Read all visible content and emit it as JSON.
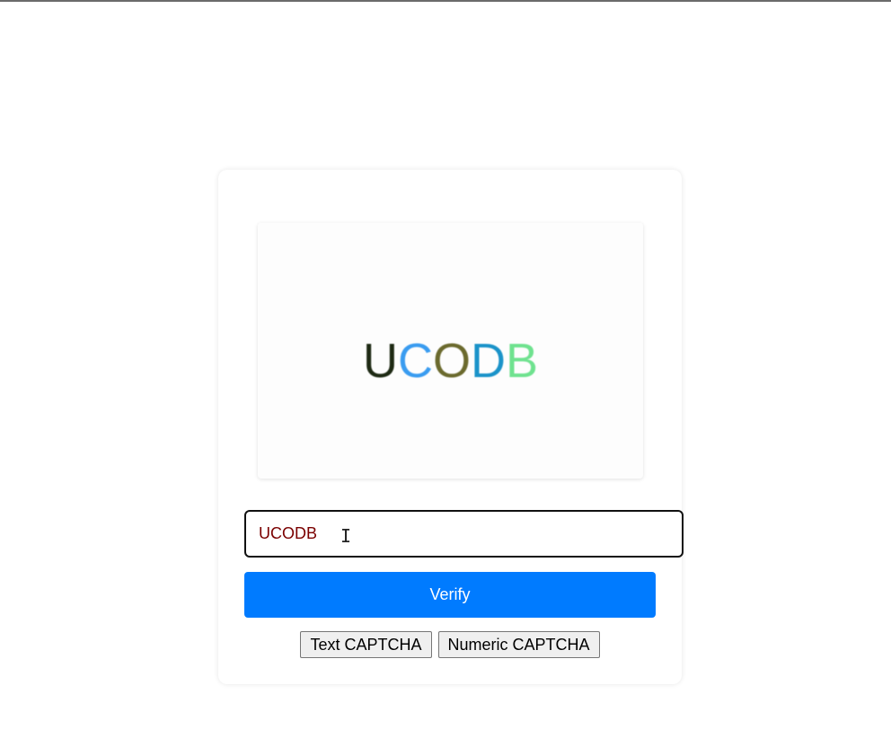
{
  "captcha": {
    "characters": [
      {
        "char": "U",
        "color": "#1e2a14"
      },
      {
        "char": "C",
        "color": "#3a9cf0"
      },
      {
        "char": "O",
        "color": "#6b6a2e"
      },
      {
        "char": "D",
        "color": "#1b93c9"
      },
      {
        "char": "B",
        "color": "#6fe28f"
      }
    ]
  },
  "answer_input": {
    "value": "UCODB",
    "text_color": "#7a0000"
  },
  "verify_button": {
    "label": "Verify",
    "color": "#007bff"
  },
  "mode_buttons": {
    "text_label": "Text CAPTCHA",
    "numeric_label": "Numeric CAPTCHA"
  }
}
